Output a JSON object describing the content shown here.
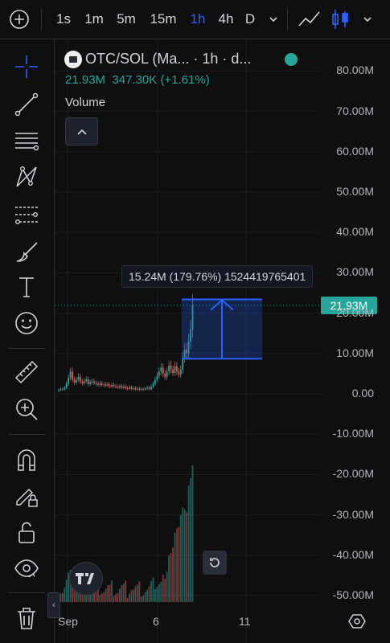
{
  "toolbar": {
    "intervals": [
      "1s",
      "1m",
      "5m",
      "15m",
      "1h",
      "4h",
      "D"
    ],
    "active_interval": "1h",
    "icons": [
      "add-circle-icon",
      "chevron-down-icon",
      "line-chart-icon",
      "candles-icon",
      "chevron-down-icon"
    ]
  },
  "left_tools": [
    "crosshair-icon",
    "trend-line-icon",
    "fib-lines-icon",
    "pattern-icon",
    "projection-icon",
    "brush-icon",
    "text-icon",
    "emoji-icon",
    "ruler-icon",
    "zoom-in-icon",
    "magnet-icon",
    "lock-drawings-icon",
    "unlock-icon",
    "eye-icon",
    "trash-icon"
  ],
  "legend": {
    "title": "OTC/SOL (Ma... · 1h · d...",
    "price": "21.93M",
    "change": "347.30K (+1.61%)",
    "indicator": "Volume"
  },
  "measure": {
    "label": "15.24M (179.76%) 1524419765401",
    "from": 8.7,
    "to": 23.4
  },
  "current_price_tag": "21.93M",
  "colors": {
    "up": "#26a69a",
    "down": "#ef5350",
    "accent": "#2962ff",
    "measure": "#2962ff"
  },
  "chart_data": {
    "type": "candlestick",
    "y_ticks": [
      "80.00M",
      "70.00M",
      "60.00M",
      "50.00M",
      "40.00M",
      "30.00M",
      "20.00M",
      "10.00M",
      "0.00",
      "-10.00M",
      "-20.00M",
      "-30.00M",
      "-40.00M",
      "-50.00M"
    ],
    "x_ticks": [
      "Sep",
      "6",
      "11"
    ],
    "ylim": [
      -51,
      82
    ],
    "current_price": 21.93,
    "candles_close": [
      0.9,
      1.2,
      1.1,
      1.5,
      2.5,
      4.0,
      5.5,
      3.5,
      2.8,
      3.5,
      4.2,
      3.0,
      2.6,
      3.2,
      3.6,
      2.4,
      2.9,
      3.1,
      2.7,
      2.5,
      2.2,
      2.6,
      2.3,
      2.1,
      2.4,
      2.0,
      1.8,
      2.2,
      1.9,
      1.7,
      1.6,
      1.9,
      1.5,
      1.8,
      1.4,
      1.3,
      1.6,
      1.2,
      1.4,
      1.1,
      1.3,
      1.0,
      1.2,
      1.1,
      1.3,
      1.5,
      1.2,
      1.8,
      2.5,
      3.5,
      4.5,
      5.5,
      6.5,
      5.0,
      4.2,
      5.5,
      7.0,
      6.0,
      5.2,
      6.8,
      5.5,
      4.8,
      6.0,
      9.0,
      11.0,
      10.0,
      13.0,
      16.0,
      21.9
    ]
  }
}
